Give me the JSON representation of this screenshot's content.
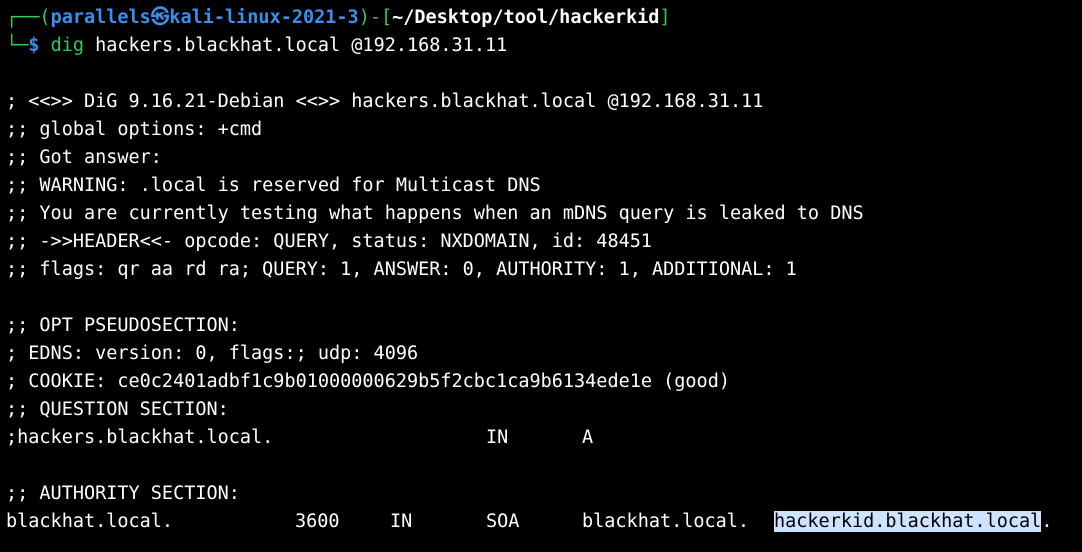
{
  "prompt": {
    "corner_top": "┌──(",
    "user": "parallels",
    "at_symbol": "㉿",
    "host": "kali-linux-2021-3",
    "close_paren": ")",
    "dash": "-[",
    "path": "~/Desktop/tool/hackerkid",
    "close_bracket": "]",
    "corner_bottom": "└─",
    "dollar": "$",
    "cmd_name": "dig",
    "cmd_args": "hackers.blackhat.local @192.168.31.11"
  },
  "output": {
    "l1": "; <<>> DiG 9.16.21-Debian <<>> hackers.blackhat.local @192.168.31.11",
    "l2": ";; global options: +cmd",
    "l3": ";; Got answer:",
    "l4": ";; WARNING: .local is reserved for Multicast DNS",
    "l5": ";; You are currently testing what happens when an mDNS query is leaked to DNS",
    "l6": ";; ->>HEADER<<- opcode: QUERY, status: NXDOMAIN, id: 48451",
    "l7": ";; flags: qr aa rd ra; QUERY: 1, ANSWER: 0, AUTHORITY: 1, ADDITIONAL: 1",
    "l8": ";; OPT PSEUDOSECTION:",
    "l9": "; EDNS: version: 0, flags:; udp: 4096",
    "l10": "; COOKIE: ce0c2401adbf1c9b01000000629b5f2cbc1ca9b6134ede1e (good)",
    "l11": ";; QUESTION SECTION:",
    "question": {
      "name": ";hackers.blackhat.local.",
      "class": "IN",
      "type": "A"
    },
    "l13": ";; AUTHORITY SECTION:",
    "authority": {
      "name": "blackhat.local.",
      "ttl": "3600",
      "class": "IN",
      "type": "SOA",
      "mname": "blackhat.local.",
      "rname_selected": "hackerkid.blackhat.local",
      "rname_tail": "."
    }
  },
  "colors": {
    "background": "#000000",
    "text": "#ffffff",
    "prompt_blue": "#3b8eea",
    "prompt_green": "#34c759",
    "selection": "#cde3ff"
  }
}
